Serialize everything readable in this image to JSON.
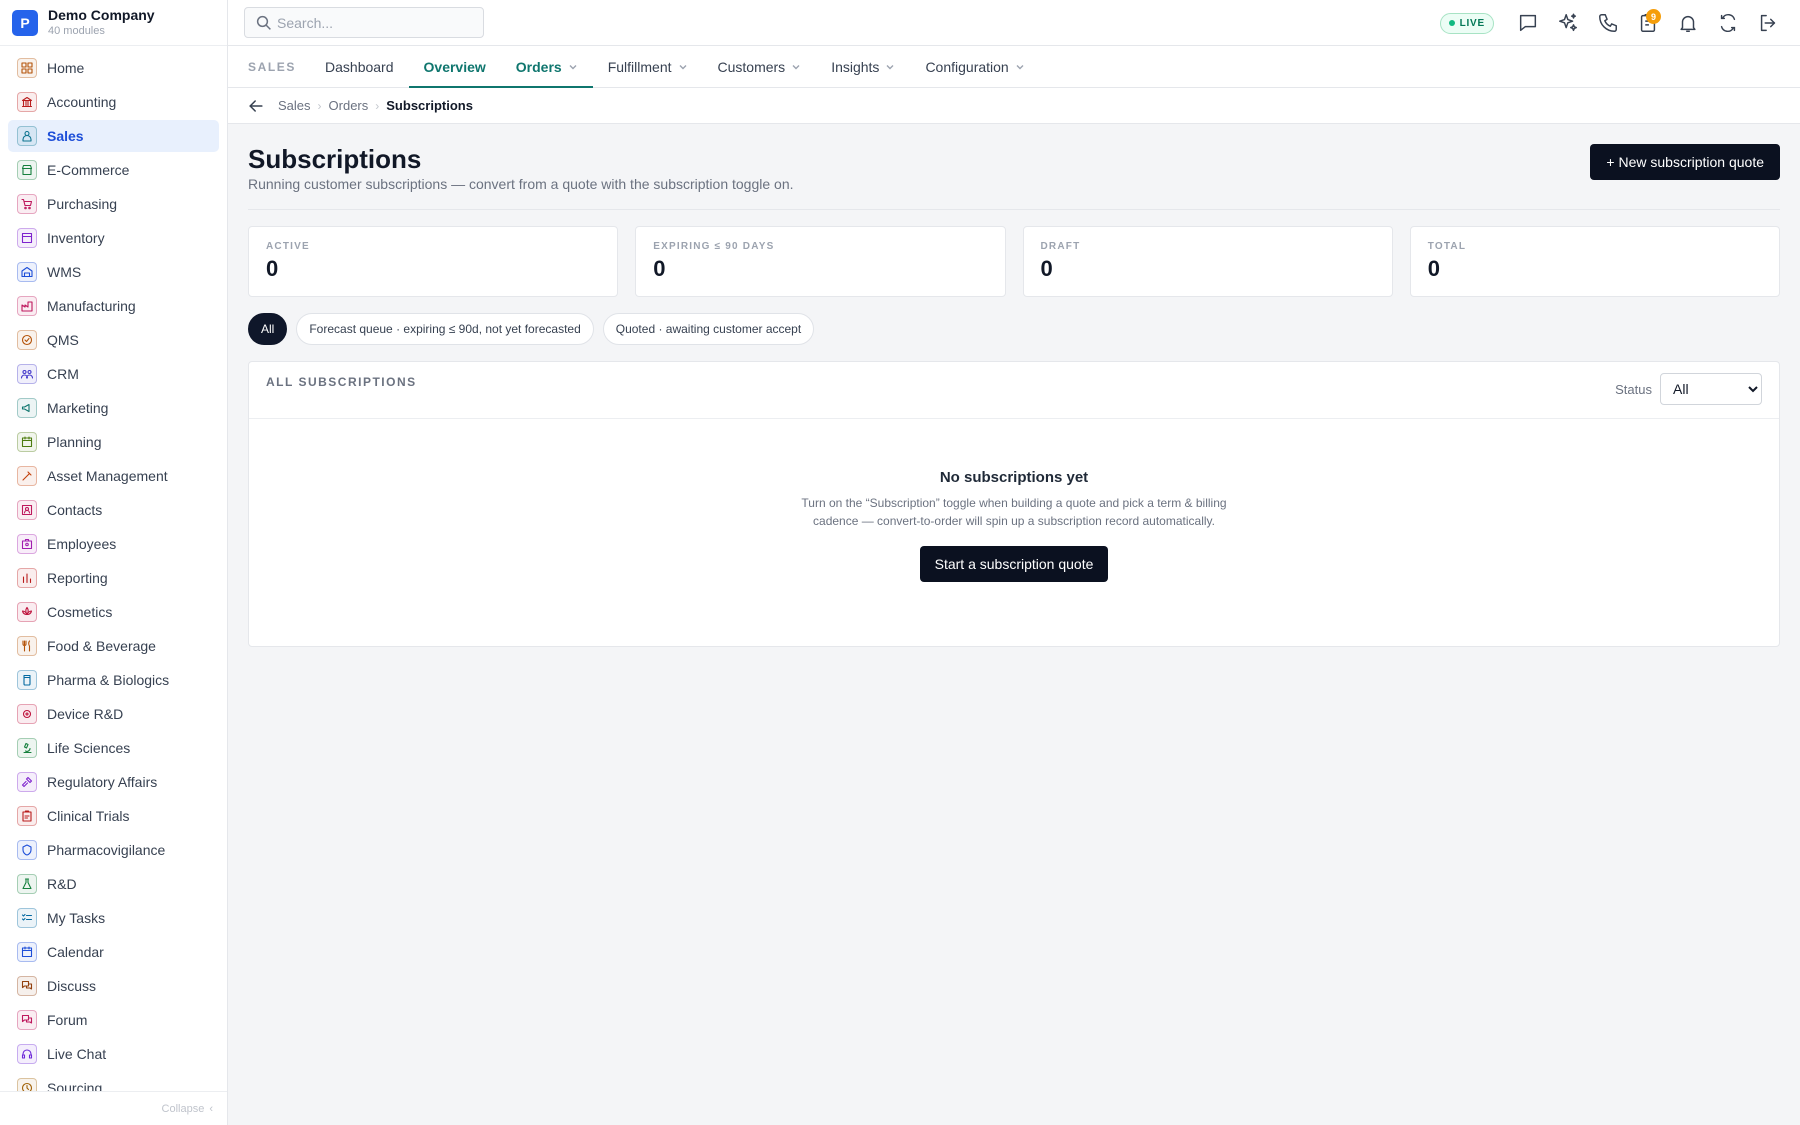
{
  "brand": {
    "logo_letter": "P",
    "name": "Demo Company",
    "subtitle": "40 modules"
  },
  "sidebar": {
    "items": [
      {
        "label": "Home",
        "icon": "home-grid-icon",
        "color": "#b45309"
      },
      {
        "label": "Accounting",
        "icon": "bank-icon",
        "color": "#b91c1c"
      },
      {
        "label": "Sales",
        "icon": "sales-person-icon",
        "color": "#0e7490",
        "active": true
      },
      {
        "label": "E-Commerce",
        "icon": "storefront-icon",
        "color": "#15803d"
      },
      {
        "label": "Purchasing",
        "icon": "cart-icon",
        "color": "#be185d"
      },
      {
        "label": "Inventory",
        "icon": "box-icon",
        "color": "#7e22ce"
      },
      {
        "label": "WMS",
        "icon": "warehouse-icon",
        "color": "#1d4ed8"
      },
      {
        "label": "Manufacturing",
        "icon": "factory-icon",
        "color": "#be185d"
      },
      {
        "label": "QMS",
        "icon": "quality-badge-icon",
        "color": "#b45309"
      },
      {
        "label": "CRM",
        "icon": "people-icon",
        "color": "#4338ca"
      },
      {
        "label": "Marketing",
        "icon": "megaphone-icon",
        "color": "#0f766e"
      },
      {
        "label": "Planning",
        "icon": "planning-calendar-icon",
        "color": "#4d7c0f"
      },
      {
        "label": "Asset Management",
        "icon": "tools-icon",
        "color": "#c2410c"
      },
      {
        "label": "Contacts",
        "icon": "contact-card-icon",
        "color": "#be185d"
      },
      {
        "label": "Employees",
        "icon": "employee-icon",
        "color": "#a21caf"
      },
      {
        "label": "Reporting",
        "icon": "bar-chart-icon",
        "color": "#b91c1c"
      },
      {
        "label": "Cosmetics",
        "icon": "lotus-icon",
        "color": "#be123c"
      },
      {
        "label": "Food & Beverage",
        "icon": "utensils-icon",
        "color": "#b45309"
      },
      {
        "label": "Pharma & Biologics",
        "icon": "pill-bottle-icon",
        "color": "#0369a1"
      },
      {
        "label": "Device R&D",
        "icon": "chip-icon",
        "color": "#be123c"
      },
      {
        "label": "Life Sciences",
        "icon": "microscope-icon",
        "color": "#15803d"
      },
      {
        "label": "Regulatory Affairs",
        "icon": "gavel-icon",
        "color": "#7e22ce"
      },
      {
        "label": "Clinical Trials",
        "icon": "clipboard-icon",
        "color": "#b91c1c"
      },
      {
        "label": "Pharmacovigilance",
        "icon": "shield-icon",
        "color": "#1d4ed8"
      },
      {
        "label": "R&D",
        "icon": "flask-icon",
        "color": "#15803d"
      },
      {
        "label": "My Tasks",
        "icon": "checklist-icon",
        "color": "#0369a1"
      },
      {
        "label": "Calendar",
        "icon": "calendar-icon",
        "color": "#1d4ed8"
      },
      {
        "label": "Discuss",
        "icon": "chat-bubbles-icon",
        "color": "#92400e"
      },
      {
        "label": "Forum",
        "icon": "forum-icon",
        "color": "#be185d"
      },
      {
        "label": "Live Chat",
        "icon": "headset-icon",
        "color": "#6d28d9"
      },
      {
        "label": "Sourcing",
        "icon": "sourcing-icon",
        "color": "#a16207"
      }
    ],
    "collapse_label": "Collapse"
  },
  "search": {
    "placeholder": "Search..."
  },
  "topbar": {
    "live_label": "LIVE",
    "icons": [
      "chat-icon",
      "sparkles-icon",
      "phone-icon",
      "clipboard-bell-icon",
      "bell-icon",
      "sync-icon",
      "logout-icon"
    ],
    "badge_count": "9"
  },
  "module_nav": {
    "module_label": "SALES",
    "tabs": [
      {
        "label": "Dashboard",
        "dropdown": false
      },
      {
        "label": "Overview",
        "dropdown": false,
        "active": true
      },
      {
        "label": "Orders",
        "dropdown": true,
        "section": true
      },
      {
        "label": "Fulfillment",
        "dropdown": true
      },
      {
        "label": "Customers",
        "dropdown": true
      },
      {
        "label": "Insights",
        "dropdown": true
      },
      {
        "label": "Configuration",
        "dropdown": true
      }
    ]
  },
  "breadcrumb": {
    "items": [
      "Sales",
      "Orders",
      "Subscriptions"
    ]
  },
  "page": {
    "title": "Subscriptions",
    "subtitle": "Running customer subscriptions — convert from a quote with the subscription toggle on.",
    "new_button": "+ New subscription quote"
  },
  "stats": [
    {
      "label": "ACTIVE",
      "value": "0"
    },
    {
      "label": "EXPIRING ≤ 90 DAYS",
      "value": "0"
    },
    {
      "label": "DRAFT",
      "value": "0"
    },
    {
      "label": "TOTAL",
      "value": "0"
    }
  ],
  "filters": [
    {
      "label": "All",
      "active": true
    },
    {
      "label": "Forecast queue · expiring ≤ 90d, not yet forecasted"
    },
    {
      "label": "Quoted · awaiting customer accept"
    }
  ],
  "panel": {
    "title": "ALL SUBSCRIPTIONS",
    "status_label": "Status",
    "status_value": "All",
    "empty_title": "No subscriptions yet",
    "empty_text": "Turn on the “Subscription” toggle when building a quote and pick a term & billing cadence — convert-to-order will spin up a subscription record automatically.",
    "empty_button": "Start a subscription quote"
  }
}
